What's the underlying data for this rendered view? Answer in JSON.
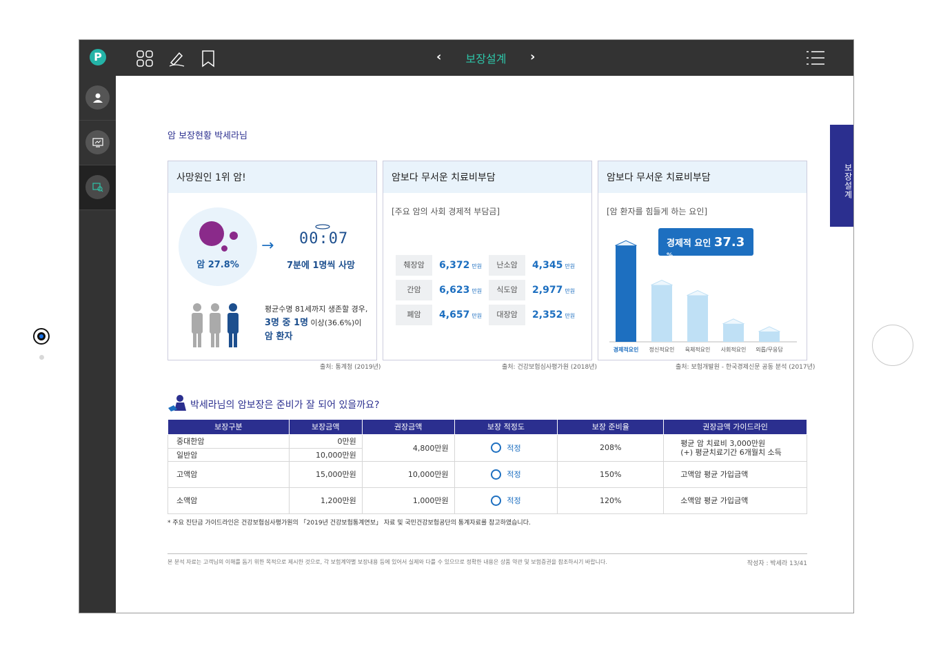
{
  "topbar": {
    "title": "보장설계",
    "logo": "P",
    "icons": [
      "grid-icon",
      "pen-icon",
      "bookmark-icon",
      "chevron-left-icon",
      "chevron-right-icon",
      "list-menu-icon"
    ]
  },
  "side_tab": {
    "label": "보장설계"
  },
  "page": {
    "title": "암 보장현황 박세라님"
  },
  "cards": [
    {
      "heading": "사망원인 1위 암!",
      "bubble_label": "암 27.8%",
      "clock": "00:07",
      "clock_caption": "7분에 1명씩 사망",
      "people_line1": "평균수명 81세까지 생존할 경우,",
      "people_big": "3명 중 1명",
      "people_line2": "이상(36.6%)이",
      "people_line3": "암 환자",
      "source": "출처: 통계청 (2019년)"
    },
    {
      "heading": "암보다 무서운 치료비부담",
      "subtitle": "[주요 암의 사회 경제적 부담금]",
      "unit": "만원",
      "costs": [
        {
          "label": "췌장암",
          "value": "6,372"
        },
        {
          "label": "난소암",
          "value": "4,345"
        },
        {
          "label": "간암",
          "value": "6,623"
        },
        {
          "label": "식도암",
          "value": "2,977"
        },
        {
          "label": "폐암",
          "value": "4,657"
        },
        {
          "label": "대장암",
          "value": "2,352"
        }
      ],
      "source": "출처: 건강보험심사평가원 (2018년)"
    },
    {
      "heading": "암보다 무서운 치료비부담",
      "subtitle": "[암 환자를 힘들게 하는 요인]",
      "callout_label": "경제적 요인",
      "callout_value": "37.3",
      "callout_unit": "%",
      "source": "출처: 보험개발원 - 한국경제신문 공동 분석 (2017년)"
    }
  ],
  "chart_data": {
    "type": "bar",
    "categories": [
      "경제적요인",
      "정신적요인",
      "육체적요인",
      "사회적요인",
      "외롭/무응답"
    ],
    "values": [
      37.3,
      22,
      18,
      7,
      4
    ],
    "highlight_color": "#1d6fc0",
    "other_color": "#bfe0f5"
  },
  "section": {
    "title": "박세라님의 암보장은 준비가 잘 되어 있을까요?"
  },
  "table": {
    "headers": [
      "보장구분",
      "보장금액",
      "권장금액",
      "보장 적정도",
      "보장 준비율",
      "권장금액 가이드라인"
    ],
    "rows": [
      {
        "sub": [
          {
            "name": "중대한암",
            "amount": "0만원"
          },
          {
            "name": "일반암",
            "amount": "10,000만원"
          }
        ],
        "recommended": "4,800만원",
        "adequacy": "적정",
        "ratio": "208%",
        "guide_line1": "평균 암 치료비 3,000만원",
        "guide_line2": "(+) 평균치료기간 6개월치 소득"
      },
      {
        "name": "고액암",
        "amount": "15,000만원",
        "recommended": "10,000만원",
        "adequacy": "적정",
        "ratio": "150%",
        "guide": "고액암 평균 가입금액"
      },
      {
        "name": "소액암",
        "amount": "1,200만원",
        "recommended": "1,000만원",
        "adequacy": "적정",
        "ratio": "120%",
        "guide": "소액암 평균 가입금액"
      }
    ]
  },
  "footnote": "* 주요 진단금 가이드라인은 건강보험심사평가원의 「2019년 건강보험통계연보」 자료 및 국민건강보험공단의 통계자료를 참고하였습니다.",
  "footer": {
    "disclaimer": "본 분석 자료는 고객님의 이해를 돕기 위한 목적으로 제시한 것으로, 각 보험계약별 보장내용 등에 있어서 실제와 다를 수 있으므로 정확한 내용은 상품 약관 및 보험증권을 참조하시기 바랍니다.",
    "author": "작성자 : 박세라 13/41"
  }
}
